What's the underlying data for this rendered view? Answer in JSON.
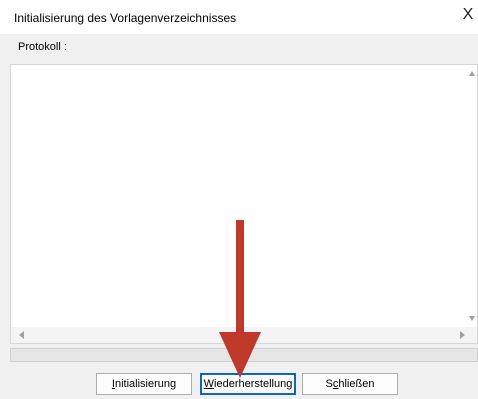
{
  "window": {
    "title": "Initialisierung des Vorlagenverzeichnisses",
    "close_glyph": "X"
  },
  "log": {
    "label": "Protokoll :",
    "content": ""
  },
  "progress": {
    "value_percent": 0
  },
  "buttons": {
    "initialize": {
      "mnemonic": "I",
      "rest": "nitialisierung"
    },
    "restore": {
      "mnemonic": "W",
      "rest": "iederherstellung"
    },
    "close": {
      "before": "S",
      "mnemonic": "c",
      "rest": "hließen"
    }
  },
  "annotation": {
    "arrow_color": "#c0392b"
  }
}
